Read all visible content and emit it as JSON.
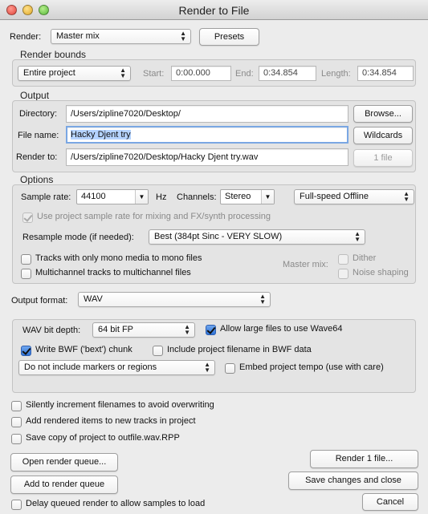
{
  "window": {
    "title": "Render to File"
  },
  "render": {
    "label": "Render:",
    "value": "Master mix",
    "presets": "Presets"
  },
  "bounds": {
    "title": "Render bounds",
    "value": "Entire project",
    "start_label": "Start:",
    "start": "0:00.000",
    "end_label": "End:",
    "end": "0:34.854",
    "length_label": "Length:",
    "length": "0:34.854"
  },
  "output": {
    "title": "Output",
    "directory_label": "Directory:",
    "directory": "/Users/zipline7020/Desktop/",
    "browse": "Browse...",
    "filename_label": "File name:",
    "filename": "Hacky Djent try",
    "wildcards": "Wildcards",
    "renderto_label": "Render to:",
    "renderto": "/Users/zipline7020/Desktop/Hacky Djent try.wav",
    "file_count": "1 file"
  },
  "options": {
    "title": "Options",
    "samplerate_label": "Sample rate:",
    "samplerate": "44100",
    "hz": "Hz",
    "channels_label": "Channels:",
    "channels": "Stereo",
    "speed": "Full-speed Offline",
    "use_project_rate": "Use project sample rate for mixing and FX/synth processing",
    "resample_label": "Resample mode (if needed):",
    "resample": "Best (384pt Sinc - VERY SLOW)",
    "mono_tracks": "Tracks with only mono media to mono files",
    "multichannel": "Multichannel tracks to multichannel files",
    "master_mix_label": "Master mix:",
    "dither": "Dither",
    "noise_shaping": "Noise shaping"
  },
  "format": {
    "label": "Output format:",
    "value": "WAV",
    "bitdepth_label": "WAV bit depth:",
    "bitdepth": "64 bit FP",
    "wave64": "Allow large files to use Wave64",
    "bwf": "Write BWF ('bext') chunk",
    "bwf_filename": "Include project filename in BWF data",
    "markers": "Do not include markers or regions",
    "tempo": "Embed project tempo (use with care)"
  },
  "misc": {
    "increment": "Silently increment filenames to avoid overwriting",
    "add_tracks": "Add rendered items to new tracks in project",
    "save_copy": "Save copy of project to outfile.wav.RPP",
    "open_queue": "Open render queue...",
    "add_queue": "Add to render queue",
    "delay_queue": "Delay queued render to allow samples to load",
    "render_btn": "Render 1 file...",
    "save_close": "Save changes and close",
    "cancel": "Cancel"
  },
  "icons": {
    "popup": "updown-arrows-icon",
    "combo": "down-caret-icon",
    "check": "checkmark-icon"
  }
}
